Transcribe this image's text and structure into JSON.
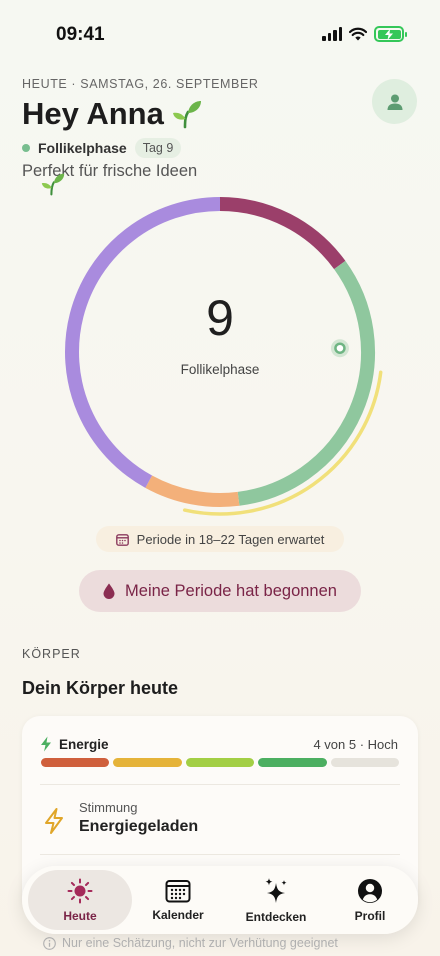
{
  "status": {
    "time": "09:41"
  },
  "header": {
    "date_line": "HEUTE · SAMSTAG, 26. SEPTEMBER",
    "greeting": "Hey Anna",
    "phase": "Follikelphase",
    "day_badge": "Tag 9",
    "tagline": "Perfekt für frische Ideen"
  },
  "cycle_ring": {
    "day": "9",
    "phase": "Follikelphase",
    "segments": [
      {
        "name": "Periode",
        "color": "#9b3f6a",
        "share": 0.15
      },
      {
        "name": "Follikelphase",
        "color": "#8fc79e",
        "share": 0.33
      },
      {
        "name": "Eisprung",
        "color": "#f3b07a",
        "share": 0.1
      },
      {
        "name": "Lutealphase",
        "color": "#a98bde",
        "share": 0.42
      }
    ],
    "marker_fraction": 0.245,
    "fertile_arc_color": "#f1e07a"
  },
  "forecast": "Periode in 18–22 Tagen erwartet",
  "period_button": "Meine Periode hat begonnen",
  "body_section": {
    "label": "KÖRPER",
    "title": "Dein Körper heute",
    "energy": {
      "label": "Energie",
      "value_text": "4 von 5 · Hoch",
      "level": 4,
      "max": 5,
      "bar_colors": [
        "#cf5f3c",
        "#e5b339",
        "#a3cf45",
        "#4caf61",
        "#e6e3dc"
      ]
    },
    "mood": {
      "label": "Stimmung",
      "value": "Energiegeladen"
    }
  },
  "disclaimer": "Nur eine Schätzung, nicht zur Verhütung geeignet",
  "tabs": [
    {
      "label": "Heute",
      "icon": "sun-icon",
      "active": true
    },
    {
      "label": "Kalender",
      "icon": "calendar-icon",
      "active": false
    },
    {
      "label": "Entdecken",
      "icon": "sparkles-icon",
      "active": false
    },
    {
      "label": "Profil",
      "icon": "person-icon",
      "active": false
    }
  ]
}
